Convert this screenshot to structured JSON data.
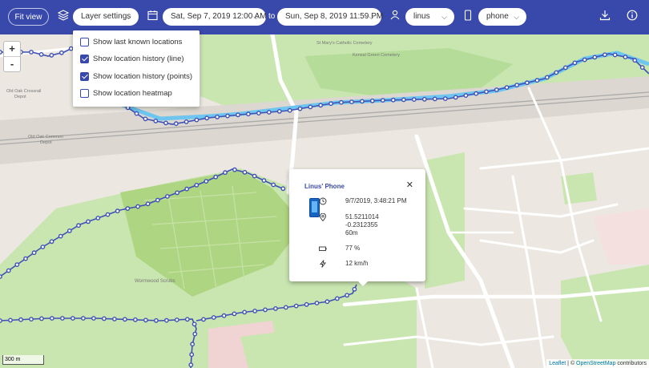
{
  "header": {
    "fit_view_label": "Fit view",
    "layer_settings_label": "Layer settings",
    "start_date": "Sat, Sep 7, 2019 12:00 AM",
    "to_label": "to",
    "end_date": "Sun, Sep 8, 2019 11:59 PM",
    "user_select": "linus",
    "device_select": "phone"
  },
  "layer_settings": {
    "options": [
      {
        "label": "Show last known locations",
        "checked": false
      },
      {
        "label": "Show location history (line)",
        "checked": true
      },
      {
        "label": "Show location history (points)",
        "checked": true
      },
      {
        "label": "Show location heatmap",
        "checked": false
      }
    ]
  },
  "zoom": {
    "in": "+",
    "out": "-"
  },
  "popup": {
    "title": "Linus' Phone",
    "close": "✕",
    "timestamp": "9/7/2019, 3:48:21 PM",
    "latitude": "51.5211014",
    "longitude": "-0.2312355",
    "accuracy": "60m",
    "battery": "77 %",
    "speed": "12 km/h"
  },
  "map_labels": {
    "old_oak_crossrail": "Old Oak Crossrail",
    "depot": "Depot",
    "old_oak_common": "Old Oak Common",
    "depot2": "Depot",
    "wormwood_scrubs": "Wormwood Scrubs",
    "catholic_cemetery": "St Mary's Catholic Cemetery",
    "kensal_green": "Kensal Green Cemetery"
  },
  "scale": "300 m",
  "attribution": {
    "leaflet": "Leaflet",
    "sep": " | © ",
    "osm": "OpenStreetMap",
    "suffix": " contributors"
  },
  "colors": {
    "header": "#3949ab",
    "track": "#3f51b5",
    "canal": "#6ec6f0"
  }
}
